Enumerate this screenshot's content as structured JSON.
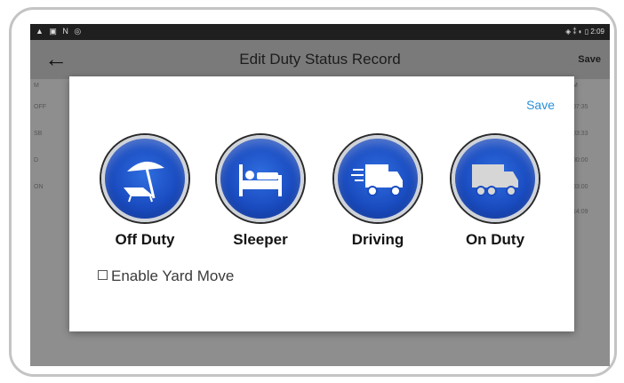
{
  "statusbar": {
    "left_icons": "▲ ▣ N ◎",
    "right_info": "◈ ⁑ ◐ ▯ 2:09"
  },
  "appbar": {
    "back_icon": "arrow-left-icon",
    "title": "Edit Duty Status Record",
    "save_label": "Save"
  },
  "background_grid": {
    "left_labels": [
      "M",
      "OFF",
      "SB",
      "D",
      "ON"
    ],
    "right_labels": [
      "M",
      "07:35",
      "03:33",
      "00:00",
      "03:00",
      "14:09"
    ]
  },
  "dialog": {
    "save_label": "Save",
    "statuses": [
      {
        "label": "Off Duty",
        "icon": "beach-umbrella-icon"
      },
      {
        "label": "Sleeper",
        "icon": "bed-icon"
      },
      {
        "label": "Driving",
        "icon": "moving-truck-icon"
      },
      {
        "label": "On Duty",
        "icon": "parked-truck-icon"
      }
    ],
    "yard_move_label": "Enable Yard Move",
    "yard_move_checked": false
  },
  "colors": {
    "accent": "#2a8fd8",
    "icon_blue": "#1a4cc0",
    "overlay": "#8e8e8e"
  }
}
